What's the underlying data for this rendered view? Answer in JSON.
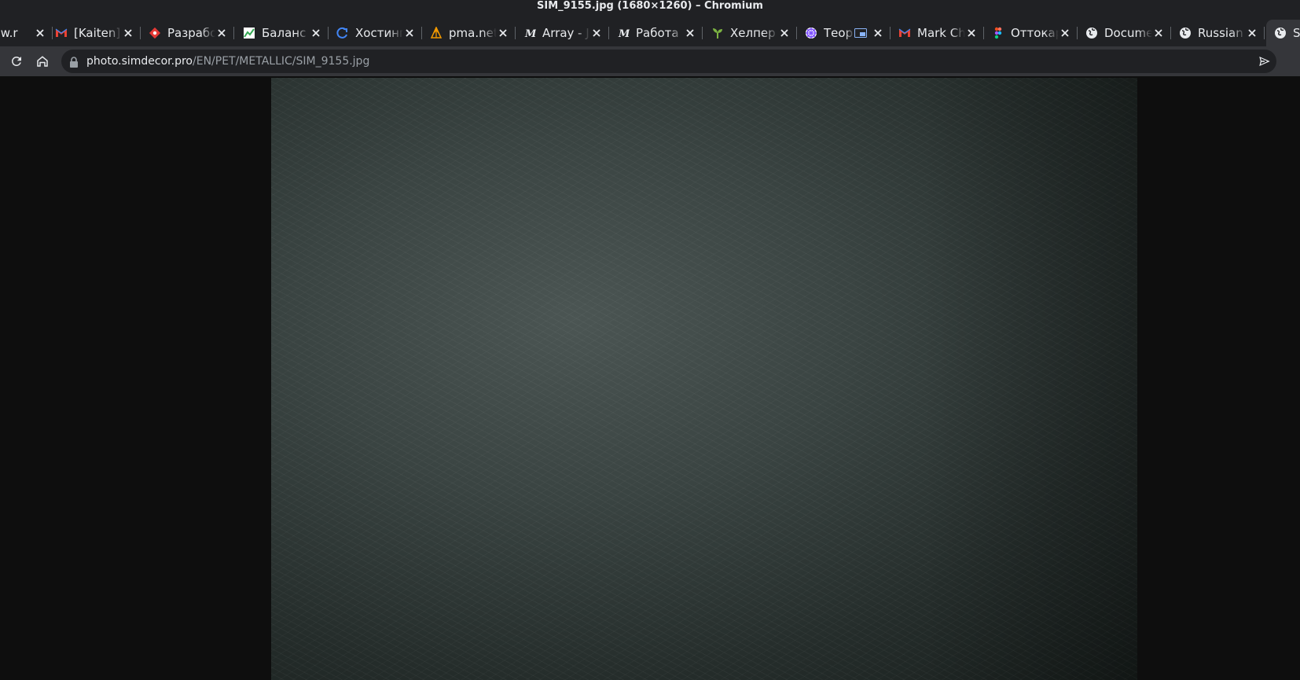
{
  "window": {
    "title": "SIM_9155.jpg (1680×1260) – Chromium"
  },
  "tabs": [
    {
      "label": "new.r",
      "favicon": "globe-icon",
      "favicon_color": "#e8eaed"
    },
    {
      "label": "[Kaiten]",
      "favicon": "gmail-icon",
      "favicon_color": "#ea4335"
    },
    {
      "label": "Разрабо",
      "favicon": "diamond-icon",
      "favicon_color": "#e53935"
    },
    {
      "label": "Баланс",
      "favicon": "chart-icon",
      "favicon_color": "#34a853"
    },
    {
      "label": "Хостинг",
      "favicon": "loop-icon",
      "favicon_color": "#4285f4"
    },
    {
      "label": "pma.net",
      "favicon": "sail-icon",
      "favicon_color": "#f29900"
    },
    {
      "label": "Array - J",
      "favicon": "medium-icon",
      "favicon_color": "#e8eaed"
    },
    {
      "label": "Работа",
      "favicon": "medium-icon",
      "favicon_color": "#e8eaed"
    },
    {
      "label": "Хелпер",
      "favicon": "sprout-icon",
      "favicon_color": "#7cb342"
    },
    {
      "label": "Теор",
      "favicon": "helm-icon",
      "favicon_color": "#8ab4f8",
      "pip": true
    },
    {
      "label": "Mark Ch",
      "favicon": "gmail-icon",
      "favicon_color": "#ea4335"
    },
    {
      "label": "Оттокар",
      "favicon": "figma-icon",
      "favicon_color": "#f24e1e"
    },
    {
      "label": "Docume",
      "favicon": "globe-icon",
      "favicon_color": "#e8eaed"
    },
    {
      "label": "Russian",
      "favicon": "globe-icon",
      "favicon_color": "#e8eaed"
    },
    {
      "label": "S",
      "favicon": "globe-icon",
      "favicon_color": "#e8eaed",
      "active": true
    }
  ],
  "toolbar": {
    "reload_icon": "reload-icon",
    "home_icon": "home-icon",
    "url_host": "photo.simdecor.pro",
    "url_path": "/EN/PET/METALLIC/SIM_9155.jpg",
    "send_icon": "send-icon"
  },
  "colors": {
    "frame": "#202124",
    "toolbar": "#35363a",
    "page_background": "#0e0e0e",
    "image_tone": "#3a4442"
  }
}
